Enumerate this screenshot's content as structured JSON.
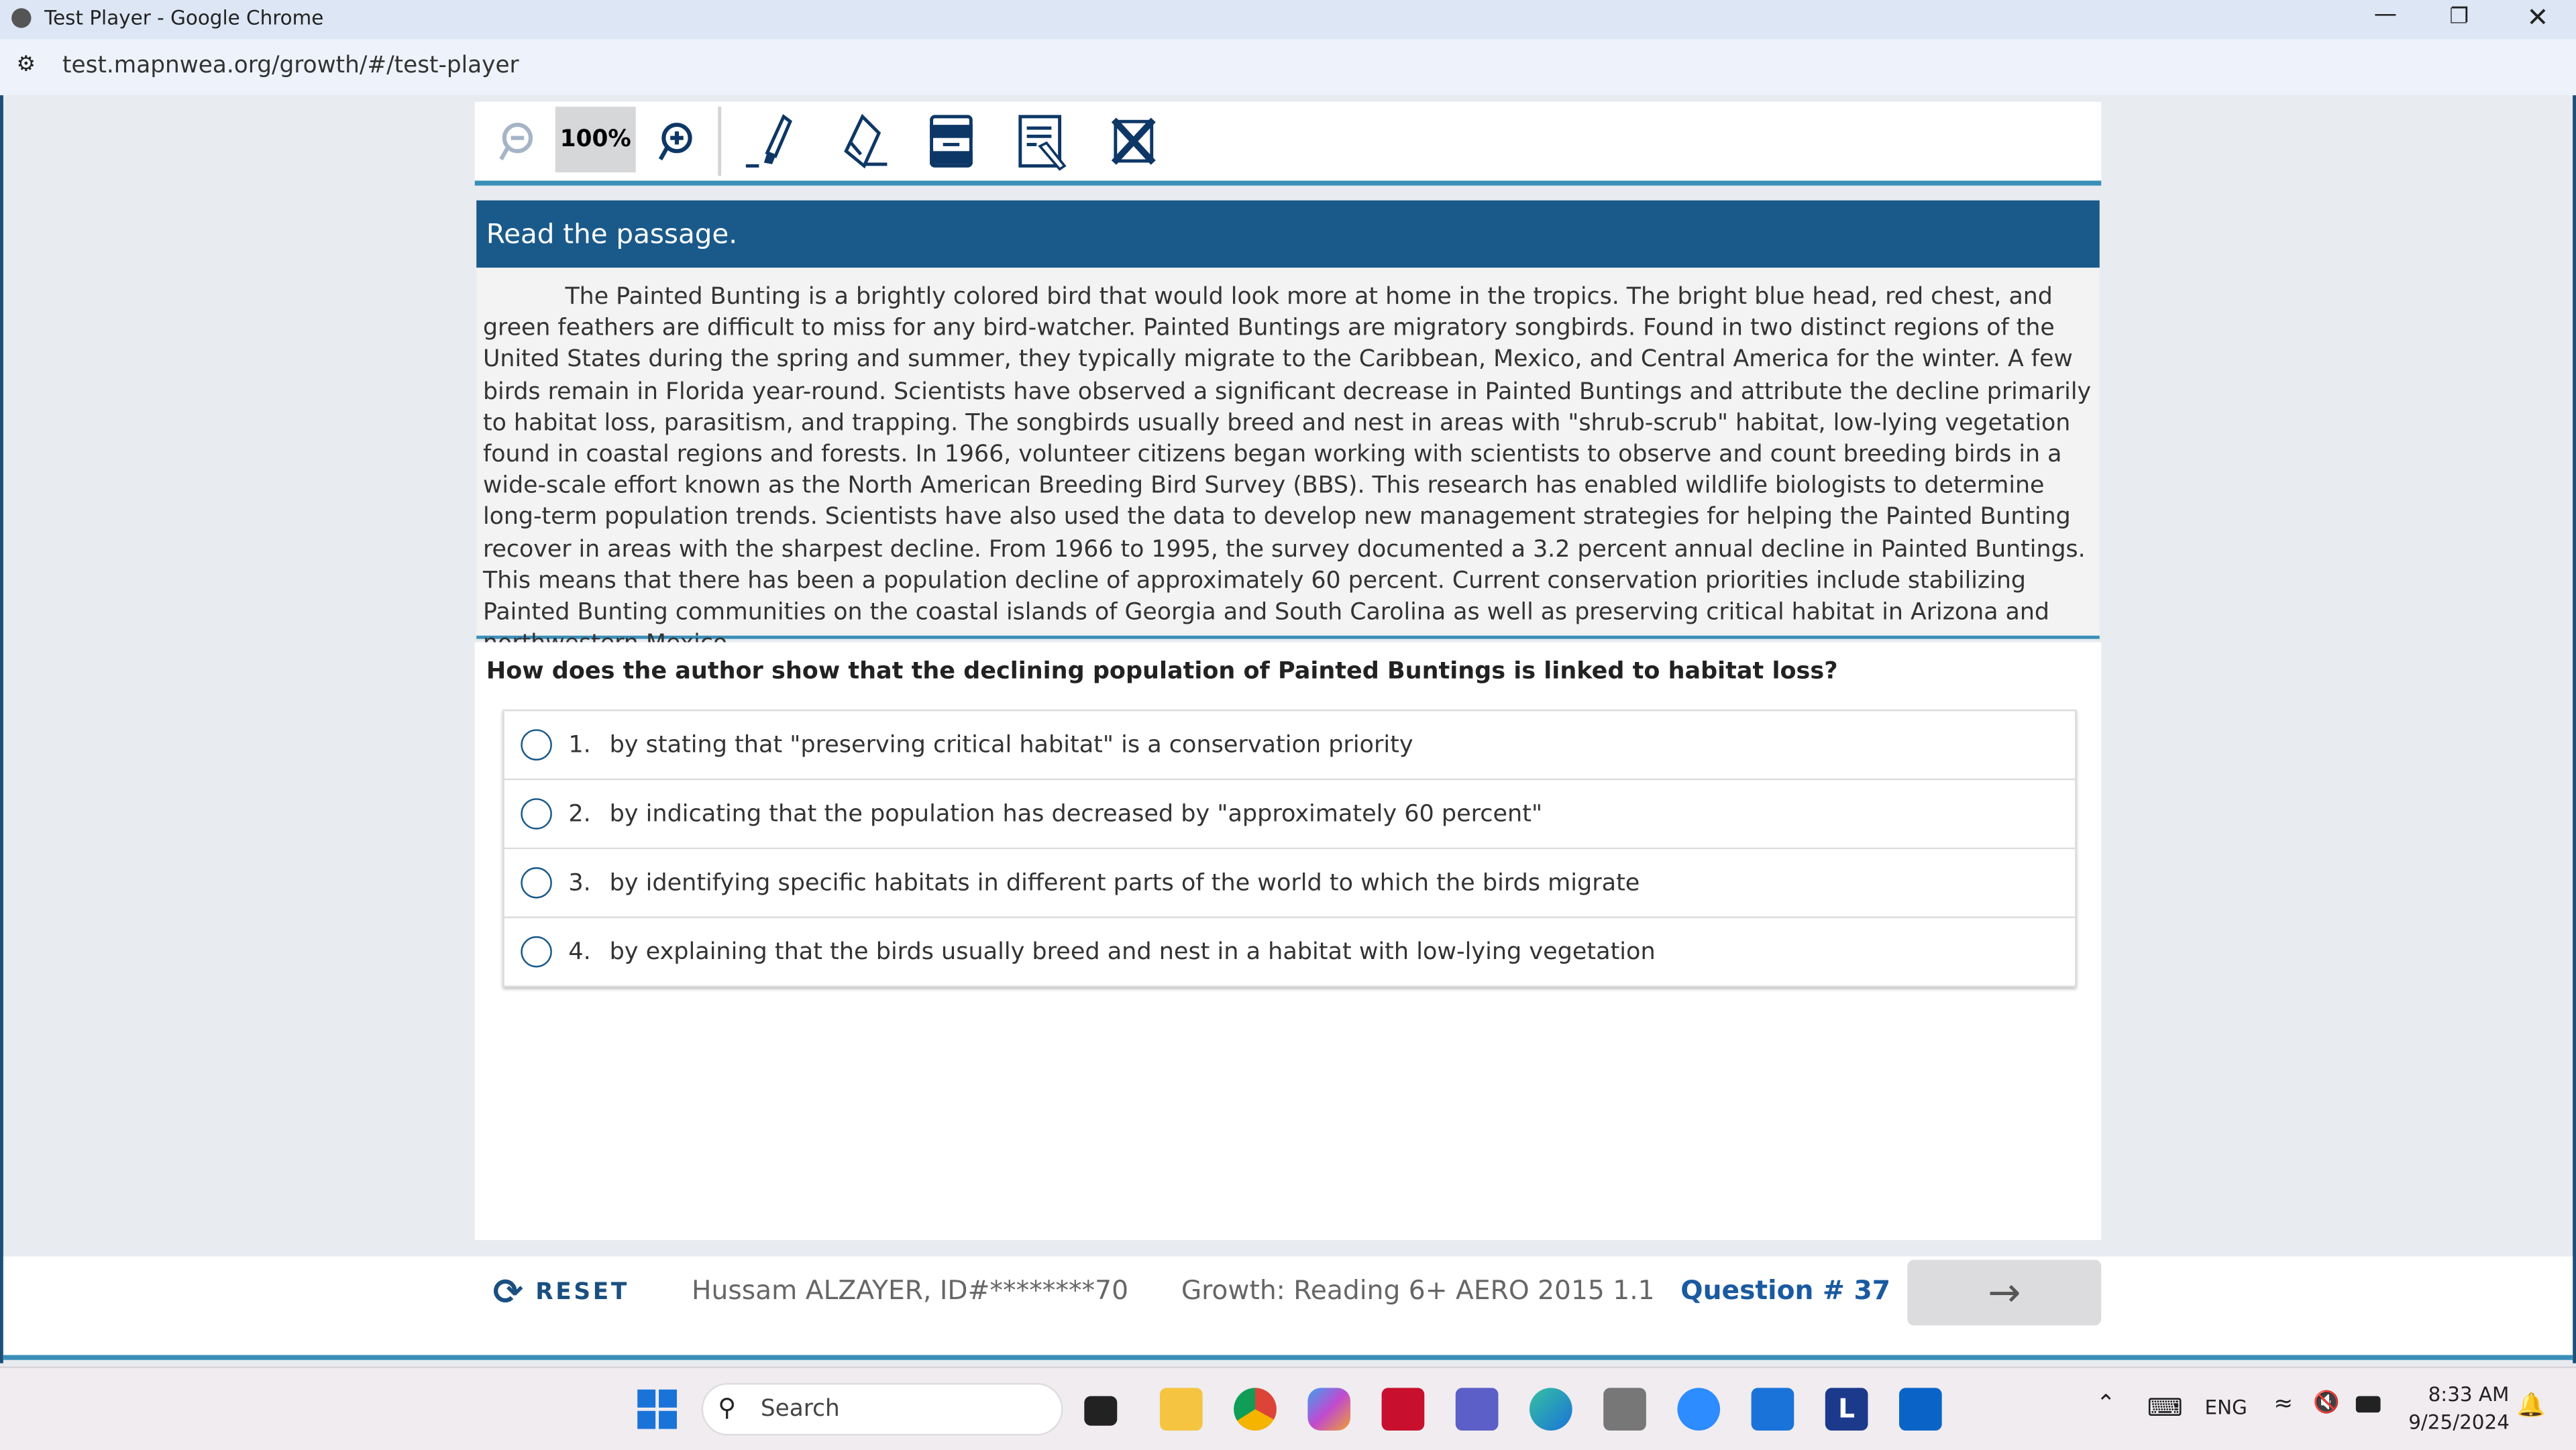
{
  "browser": {
    "window_title": "Test Player - Google Chrome",
    "url": "test.mapnwea.org/growth/#/test-player"
  },
  "toolbar": {
    "zoom_level": "100%",
    "tools": [
      "zoom-out",
      "zoom-in",
      "highlighter",
      "eraser",
      "line-reader",
      "notepad",
      "answer-eliminator"
    ]
  },
  "passage": {
    "heading": "Read the passage.",
    "text": "The Painted Bunting is a brightly colored bird that would look more at home in the tropics. The bright blue head, red chest, and green feathers are difficult to miss for any bird-watcher. Painted Buntings are migratory songbirds. Found in two distinct regions of the United States during the spring and summer, they typically migrate to the Caribbean, Mexico, and Central America for the winter. A few birds remain in Florida year-round. Scientists have observed a significant decrease in Painted Buntings and attribute the decline primarily to habitat loss, parasitism, and trapping. The songbirds usually breed and nest in areas with \"shrub-scrub\" habitat, low-lying vegetation found in coastal regions and forests. In 1966, volunteer citizens began working with scientists to observe and count breeding birds in a wide-scale effort known as the North American Breeding Bird Survey (BBS). This research has enabled wildlife biologists to determine long-term population trends. Scientists have also used the data to develop new management strategies for helping the Painted Bunting recover in areas with the sharpest decline. From 1966 to 1995, the survey documented a 3.2 percent annual decline in Painted Buntings. This means that there has been a population decline of approximately 60 percent. Current conservation priorities include stabilizing Painted Bunting communities on the coastal islands of Georgia and South Carolina as well as preserving critical habitat in Arizona and northwestern Mexico."
  },
  "question": {
    "text": "How does the author show that the declining population of Painted Buntings is linked to habitat loss?",
    "options": [
      {
        "number": "1.",
        "text": "by stating that \"preserving critical habitat\" is a conservation priority"
      },
      {
        "number": "2.",
        "text": "by indicating that the population has decreased by \"approximately 60 percent\""
      },
      {
        "number": "3.",
        "text": "by identifying specific habitats in different parts of the world to which the birds migrate"
      },
      {
        "number": "4.",
        "text": "by explaining that the birds usually breed and nest in a habitat with low-lying vegetation"
      }
    ]
  },
  "footer": {
    "reset_label": "RESET",
    "student": "Hussam ALZAYER, ID#********70",
    "test_name": "Growth: Reading 6+ AERO 2015 1.1",
    "question_number": "Question # 37",
    "next_icon": "arrow-right"
  },
  "taskbar": {
    "search_placeholder": "Search",
    "language": "ENG",
    "time": "8:33 AM",
    "date": "9/25/2024"
  },
  "colors": {
    "header": "#1a5a8a",
    "accent": "#3a8fb7",
    "question_number": "#1a5aa0"
  }
}
